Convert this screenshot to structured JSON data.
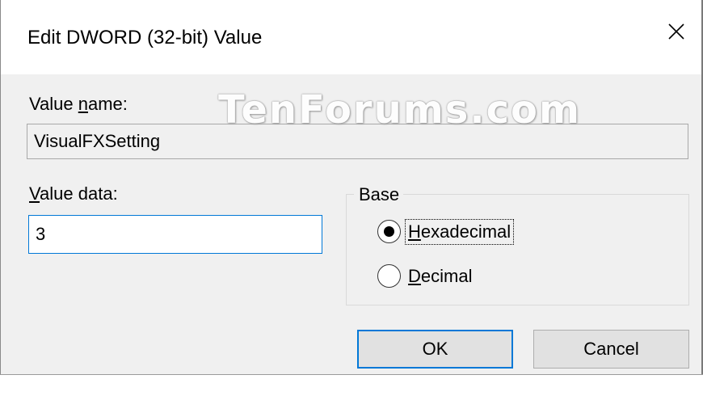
{
  "window": {
    "title": "Edit DWORD (32-bit) Value",
    "close_icon": "close-icon"
  },
  "value_name": {
    "label_underlined": "n",
    "label_before": "Value ",
    "label_after": "ame:",
    "value": "VisualFXSetting"
  },
  "value_data": {
    "label_underlined": "V",
    "label_after": "alue data:",
    "value": "3"
  },
  "base": {
    "legend": "Base",
    "options": [
      {
        "accel": "H",
        "rest": "exadecimal",
        "selected": true
      },
      {
        "accel": "D",
        "rest": "ecimal",
        "selected": false
      }
    ]
  },
  "buttons": {
    "ok": "OK",
    "cancel": "Cancel"
  },
  "watermark": "TenForums.com",
  "colors": {
    "accent": "#0078d7",
    "dialog_bg": "#f0f0f0",
    "title_bg": "#ffffff"
  }
}
